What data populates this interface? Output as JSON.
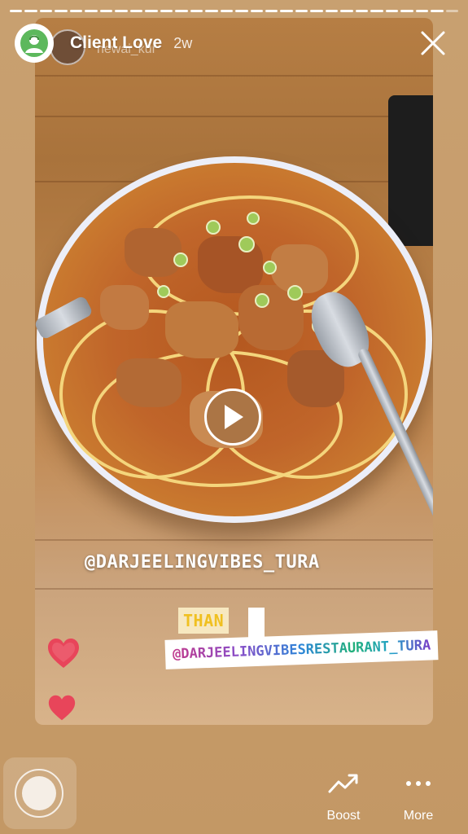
{
  "story": {
    "title": "Client Love",
    "time": "2w",
    "original_user": "newai_kur",
    "progress_total": 30,
    "progress_done": 29
  },
  "stickers": {
    "mention_1": "@DARJEELINGVIBES_TURA",
    "than": "THAN",
    "mention_2": "@DARJEELINGVIBESRESTAURANT_TURA"
  },
  "colors": {
    "background": "#c99f6e",
    "heart": "#e8455a",
    "than_text": "#f0c020"
  },
  "actions": {
    "boost_label": "Boost",
    "more_label": "More"
  },
  "icons": [
    "close-icon",
    "play-icon",
    "heart-icon",
    "boost-icon",
    "more-icon",
    "camera-shutter-icon"
  ]
}
